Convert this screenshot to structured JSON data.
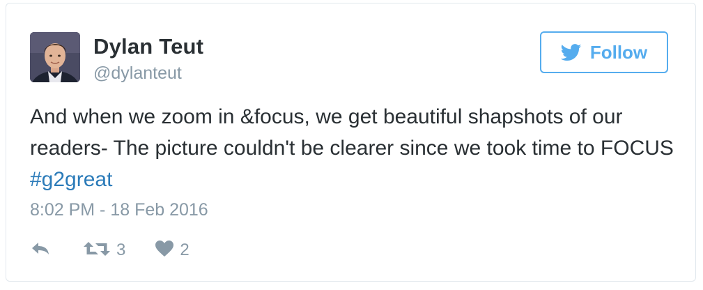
{
  "user": {
    "display_name": "Dylan Teut",
    "screen_name": "@dylanteut"
  },
  "follow_button": {
    "label": "Follow",
    "icon": "twitter-bird-icon"
  },
  "tweet": {
    "text_before_hashtag": "And when we zoom in &focus, we get beautiful shapshots of our readers- The picture couldn't be clearer since we took time to FOCUS ",
    "hashtag": "#g2great",
    "timestamp": "8:02 PM - 18 Feb 2016"
  },
  "actions": {
    "reply_icon": "reply-icon",
    "retweet_icon": "retweet-icon",
    "retweet_count": "3",
    "like_icon": "heart-icon",
    "like_count": "2"
  },
  "colors": {
    "accent": "#55acee",
    "hashtag": "#2b7bb9",
    "text": "#292f33",
    "muted": "#8899a6",
    "border": "#e1e8ed"
  }
}
